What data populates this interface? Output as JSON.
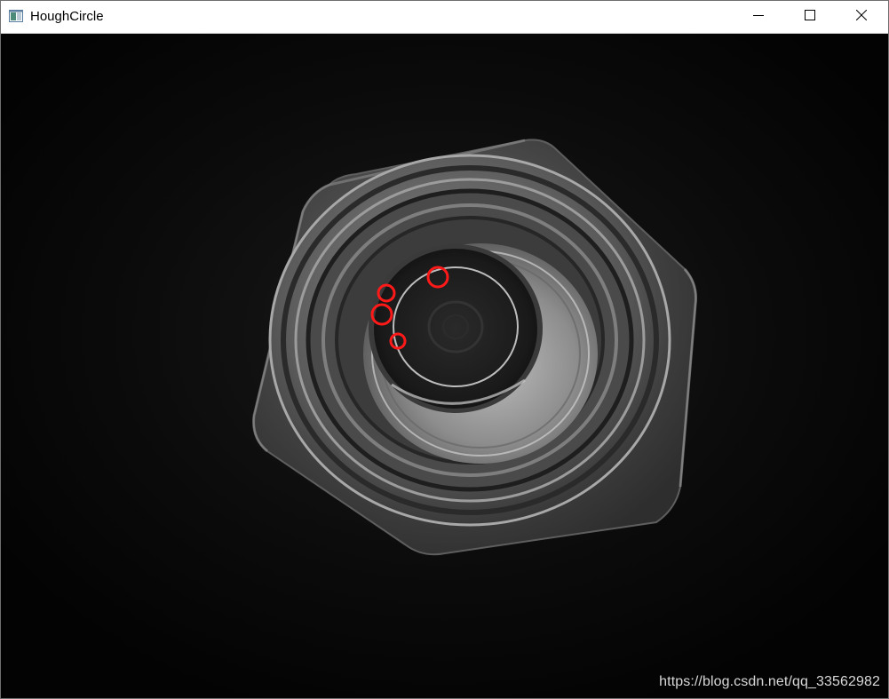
{
  "window": {
    "title": "HoughCircle",
    "icon": "opencv-window-icon",
    "controls": [
      "minimize-icon",
      "maximize-icon",
      "close-icon"
    ]
  },
  "image": {
    "subject": "grayscale top-down photo of a hex nut / threaded fitting",
    "detected_circle_color": "#ff1a1a",
    "detected_circle_count": 4
  },
  "watermark": {
    "text": "https://blog.csdn.net/qq_33562982"
  }
}
